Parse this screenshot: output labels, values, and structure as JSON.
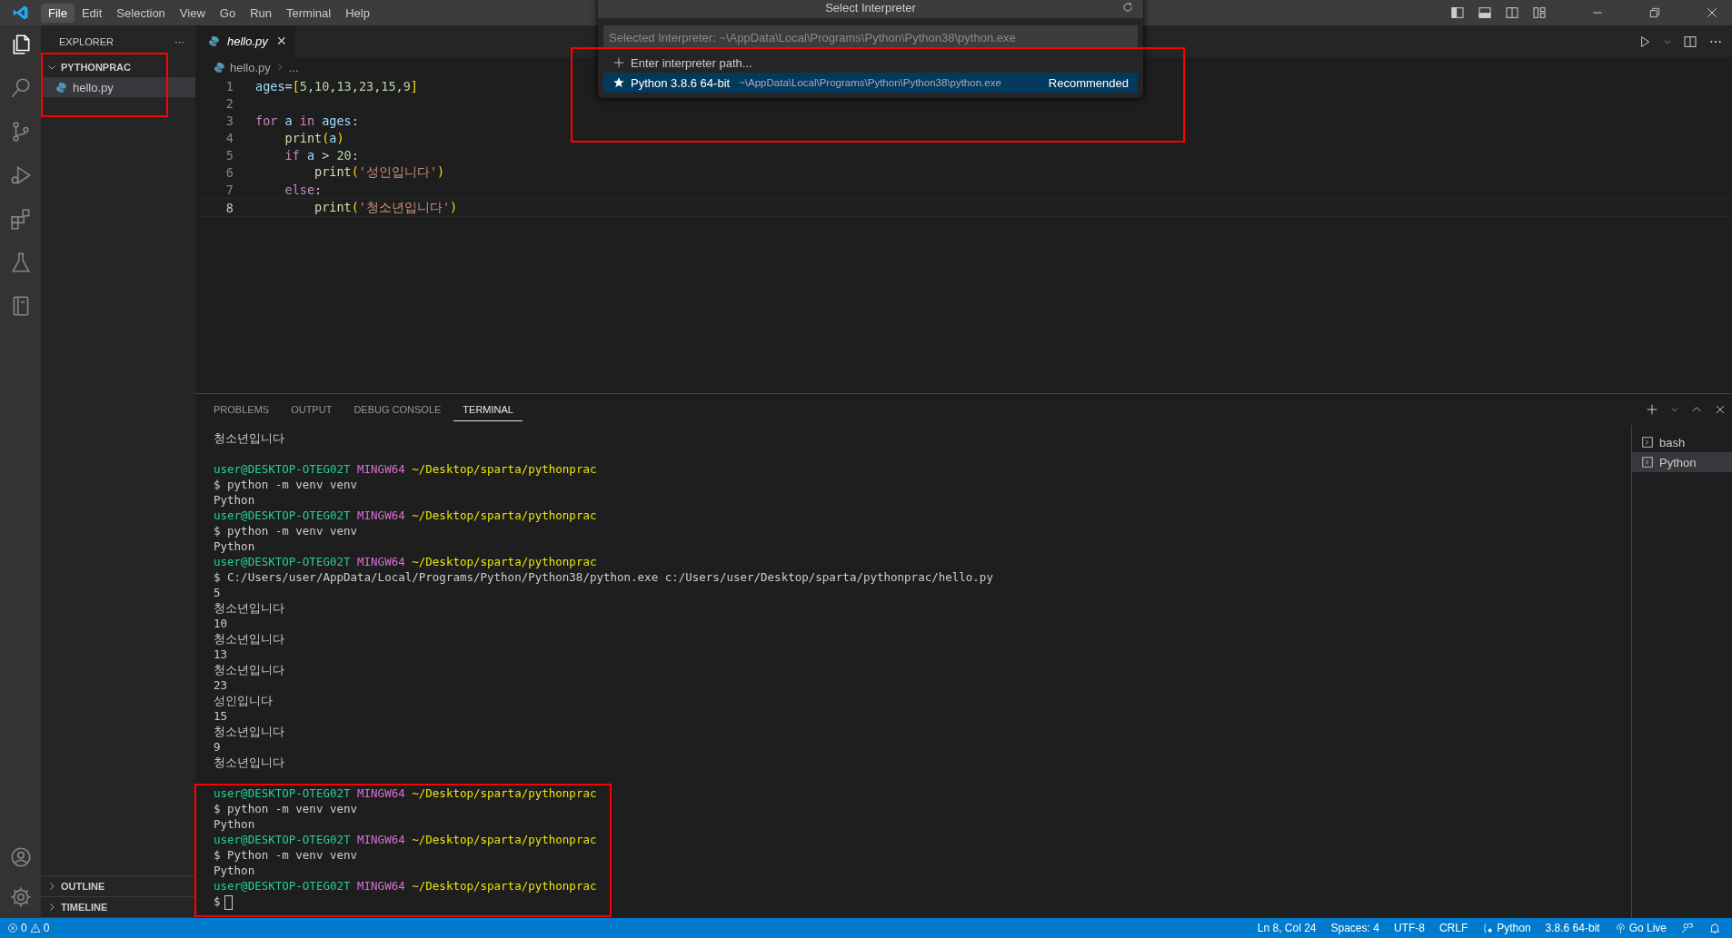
{
  "menu": [
    {
      "label": "File",
      "selected": true
    },
    {
      "label": "Edit",
      "selected": false
    },
    {
      "label": "Selection",
      "selected": false
    },
    {
      "label": "View",
      "selected": false
    },
    {
      "label": "Go",
      "selected": false
    },
    {
      "label": "Run",
      "selected": false
    },
    {
      "label": "Terminal",
      "selected": false
    },
    {
      "label": "Help",
      "selected": false
    }
  ],
  "activity_bar": [
    {
      "kind": "files",
      "selected": true
    },
    {
      "kind": "search",
      "selected": false
    },
    {
      "kind": "source",
      "selected": false
    },
    {
      "kind": "debug",
      "selected": false
    },
    {
      "kind": "extensions",
      "selected": false
    },
    {
      "kind": "flask",
      "selected": false
    },
    {
      "kind": "book",
      "selected": false
    }
  ],
  "sidebar": {
    "title": "EXPLORER",
    "more": "···",
    "folder": {
      "name": "PYTHONPRAC",
      "expanded": true,
      "children": [
        {
          "name": "hello.py",
          "selected": true
        }
      ]
    },
    "sections": [
      {
        "name": "OUTLINE",
        "expanded": false
      },
      {
        "name": "TIMELINE",
        "expanded": false
      }
    ]
  },
  "editor": {
    "tab": {
      "name": "hello.py",
      "close": "×"
    },
    "breadcrumb": [
      "hello.py",
      "..."
    ],
    "lines": [
      {
        "number": "1",
        "current": false,
        "tokens": [
          {
            "kind": "var",
            "text": "ages"
          },
          {
            "kind": "op",
            "text": "="
          },
          {
            "kind": "bracket",
            "text": "["
          },
          {
            "kind": "num",
            "text": "5"
          },
          {
            "kind": "op",
            "text": ","
          },
          {
            "kind": "num",
            "text": "10"
          },
          {
            "kind": "op",
            "text": ","
          },
          {
            "kind": "num",
            "text": "13"
          },
          {
            "kind": "op",
            "text": ","
          },
          {
            "kind": "num",
            "text": "23"
          },
          {
            "kind": "op",
            "text": ","
          },
          {
            "kind": "num",
            "text": "15"
          },
          {
            "kind": "op",
            "text": ","
          },
          {
            "kind": "num",
            "text": "9"
          },
          {
            "kind": "bracket",
            "text": "]"
          }
        ]
      },
      {
        "number": "2",
        "current": false
      },
      {
        "number": "3",
        "current": false,
        "tokens": [
          {
            "kind": "kw",
            "text": "for "
          },
          {
            "kind": "var",
            "text": "a "
          },
          {
            "kind": "kw",
            "text": "in "
          },
          {
            "kind": "var",
            "text": "ages"
          },
          {
            "kind": "op",
            "text": ":"
          }
        ]
      },
      {
        "number": "4",
        "current": false,
        "tokens": [
          {
            "kind": "fn",
            "text": "    print"
          },
          {
            "kind": "bracket",
            "text": "("
          },
          {
            "kind": "var",
            "text": "a"
          },
          {
            "kind": "bracket",
            "text": ")"
          }
        ]
      },
      {
        "number": "5",
        "current": false,
        "tokens": [
          {
            "kind": "kw",
            "text": "    if "
          },
          {
            "kind": "var",
            "text": "a"
          },
          {
            "kind": "op",
            "text": " > "
          },
          {
            "kind": "num",
            "text": "20"
          },
          {
            "kind": "op",
            "text": ":"
          }
        ]
      },
      {
        "number": "6",
        "current": false,
        "tokens": [
          {
            "kind": "fn",
            "text": "        print"
          },
          {
            "kind": "bracket",
            "text": "("
          },
          {
            "kind": "str",
            "text": "'성인입니다'"
          },
          {
            "kind": "bracket",
            "text": ")"
          }
        ]
      },
      {
        "number": "7",
        "current": false,
        "tokens": [
          {
            "kind": "kw",
            "text": "    else"
          },
          {
            "kind": "op",
            "text": ":"
          }
        ]
      },
      {
        "number": "8",
        "current": true,
        "tokens": [
          {
            "kind": "fn",
            "text": "        print"
          },
          {
            "kind": "bracket",
            "text": "("
          },
          {
            "kind": "str",
            "text": "'청소년입니다'"
          },
          {
            "kind": "bracket",
            "text": ")"
          }
        ]
      }
    ]
  },
  "quick_pick": {
    "title": "Select Interpreter",
    "input": {
      "placeholder": "Selected Interpreter: ~\\AppData\\Local\\Programs\\Python\\Python38\\python.exe"
    },
    "items": [
      {
        "kind": "add",
        "label": "Enter interpreter path...",
        "selected": false
      },
      {
        "kind": "star",
        "label": "Python 3.8.6 64-bit",
        "detail": "~\\AppData\\Local\\Programs\\Python\\Python38\\python.exe",
        "badge": "Recommended",
        "selected": true
      }
    ]
  },
  "panel": {
    "tabs": [
      {
        "label": "PROBLEMS",
        "selected": false
      },
      {
        "label": "OUTPUT",
        "selected": false
      },
      {
        "label": "DEBUG CONSOLE",
        "selected": false
      },
      {
        "label": "TERMINAL",
        "selected": true
      }
    ],
    "terminal_lines": [
      {
        "kind": "text",
        "text": "청소년입니다"
      },
      {
        "kind": "blank"
      },
      {
        "kind": "prompt",
        "user": "user@DESKTOP-OTEG02T",
        "shell": "MINGW64",
        "path": "~/Desktop/sparta/pythonprac"
      },
      {
        "kind": "text",
        "text": "$ python -m venv venv"
      },
      {
        "kind": "text",
        "text": "Python"
      },
      {
        "kind": "prompt",
        "user": "user@DESKTOP-OTEG02T",
        "shell": "MINGW64",
        "path": "~/Desktop/sparta/pythonprac"
      },
      {
        "kind": "text",
        "text": "$ python -m venv venv"
      },
      {
        "kind": "text",
        "text": "Python"
      },
      {
        "kind": "prompt",
        "user": "user@DESKTOP-OTEG02T",
        "shell": "MINGW64",
        "path": "~/Desktop/sparta/pythonprac"
      },
      {
        "kind": "text",
        "text": "$ C:/Users/user/AppData/Local/Programs/Python/Python38/python.exe c:/Users/user/Desktop/sparta/pythonprac/hello.py"
      },
      {
        "kind": "text",
        "text": "5"
      },
      {
        "kind": "text",
        "text": "청소년입니다"
      },
      {
        "kind": "text",
        "text": "10"
      },
      {
        "kind": "text",
        "text": "청소년입니다"
      },
      {
        "kind": "text",
        "text": "13"
      },
      {
        "kind": "text",
        "text": "청소년입니다"
      },
      {
        "kind": "text",
        "text": "23"
      },
      {
        "kind": "text",
        "text": "성인입니다"
      },
      {
        "kind": "text",
        "text": "15"
      },
      {
        "kind": "text",
        "text": "청소년입니다"
      },
      {
        "kind": "text",
        "text": "9"
      },
      {
        "kind": "text",
        "text": "청소년입니다"
      },
      {
        "kind": "blank"
      },
      {
        "kind": "prompt",
        "user": "user@DESKTOP-OTEG02T",
        "shell": "MINGW64",
        "path": "~/Desktop/sparta/pythonprac"
      },
      {
        "kind": "text",
        "text": "$ python -m venv venv"
      },
      {
        "kind": "text",
        "text": "Python"
      },
      {
        "kind": "prompt",
        "user": "user@DESKTOP-OTEG02T",
        "shell": "MINGW64",
        "path": "~/Desktop/sparta/pythonprac"
      },
      {
        "kind": "text",
        "text": "$ Python -m venv venv"
      },
      {
        "kind": "text",
        "text": "Python"
      },
      {
        "kind": "prompt",
        "user": "user@DESKTOP-OTEG02T",
        "shell": "MINGW64",
        "path": "~/Desktop/sparta/pythonprac"
      },
      {
        "kind": "cursor",
        "text": "$"
      }
    ],
    "terminals": [
      {
        "name": "bash",
        "selected": false
      },
      {
        "name": "Python",
        "selected": true
      }
    ]
  },
  "status_bar": {
    "errors": "0",
    "warnings": "0",
    "items": [
      {
        "kind": "text",
        "text": "Ln 8, Col 24"
      },
      {
        "kind": "text",
        "text": "Spaces: 4"
      },
      {
        "kind": "text",
        "text": "UTF-8"
      },
      {
        "kind": "text",
        "text": "CRLF"
      },
      {
        "kind": "lang",
        "text": "Python"
      },
      {
        "kind": "text",
        "text": "3.8.6 64-bit"
      },
      {
        "kind": "live",
        "text": "Go Live"
      },
      {
        "kind": "feedback"
      },
      {
        "kind": "bell"
      }
    ]
  }
}
